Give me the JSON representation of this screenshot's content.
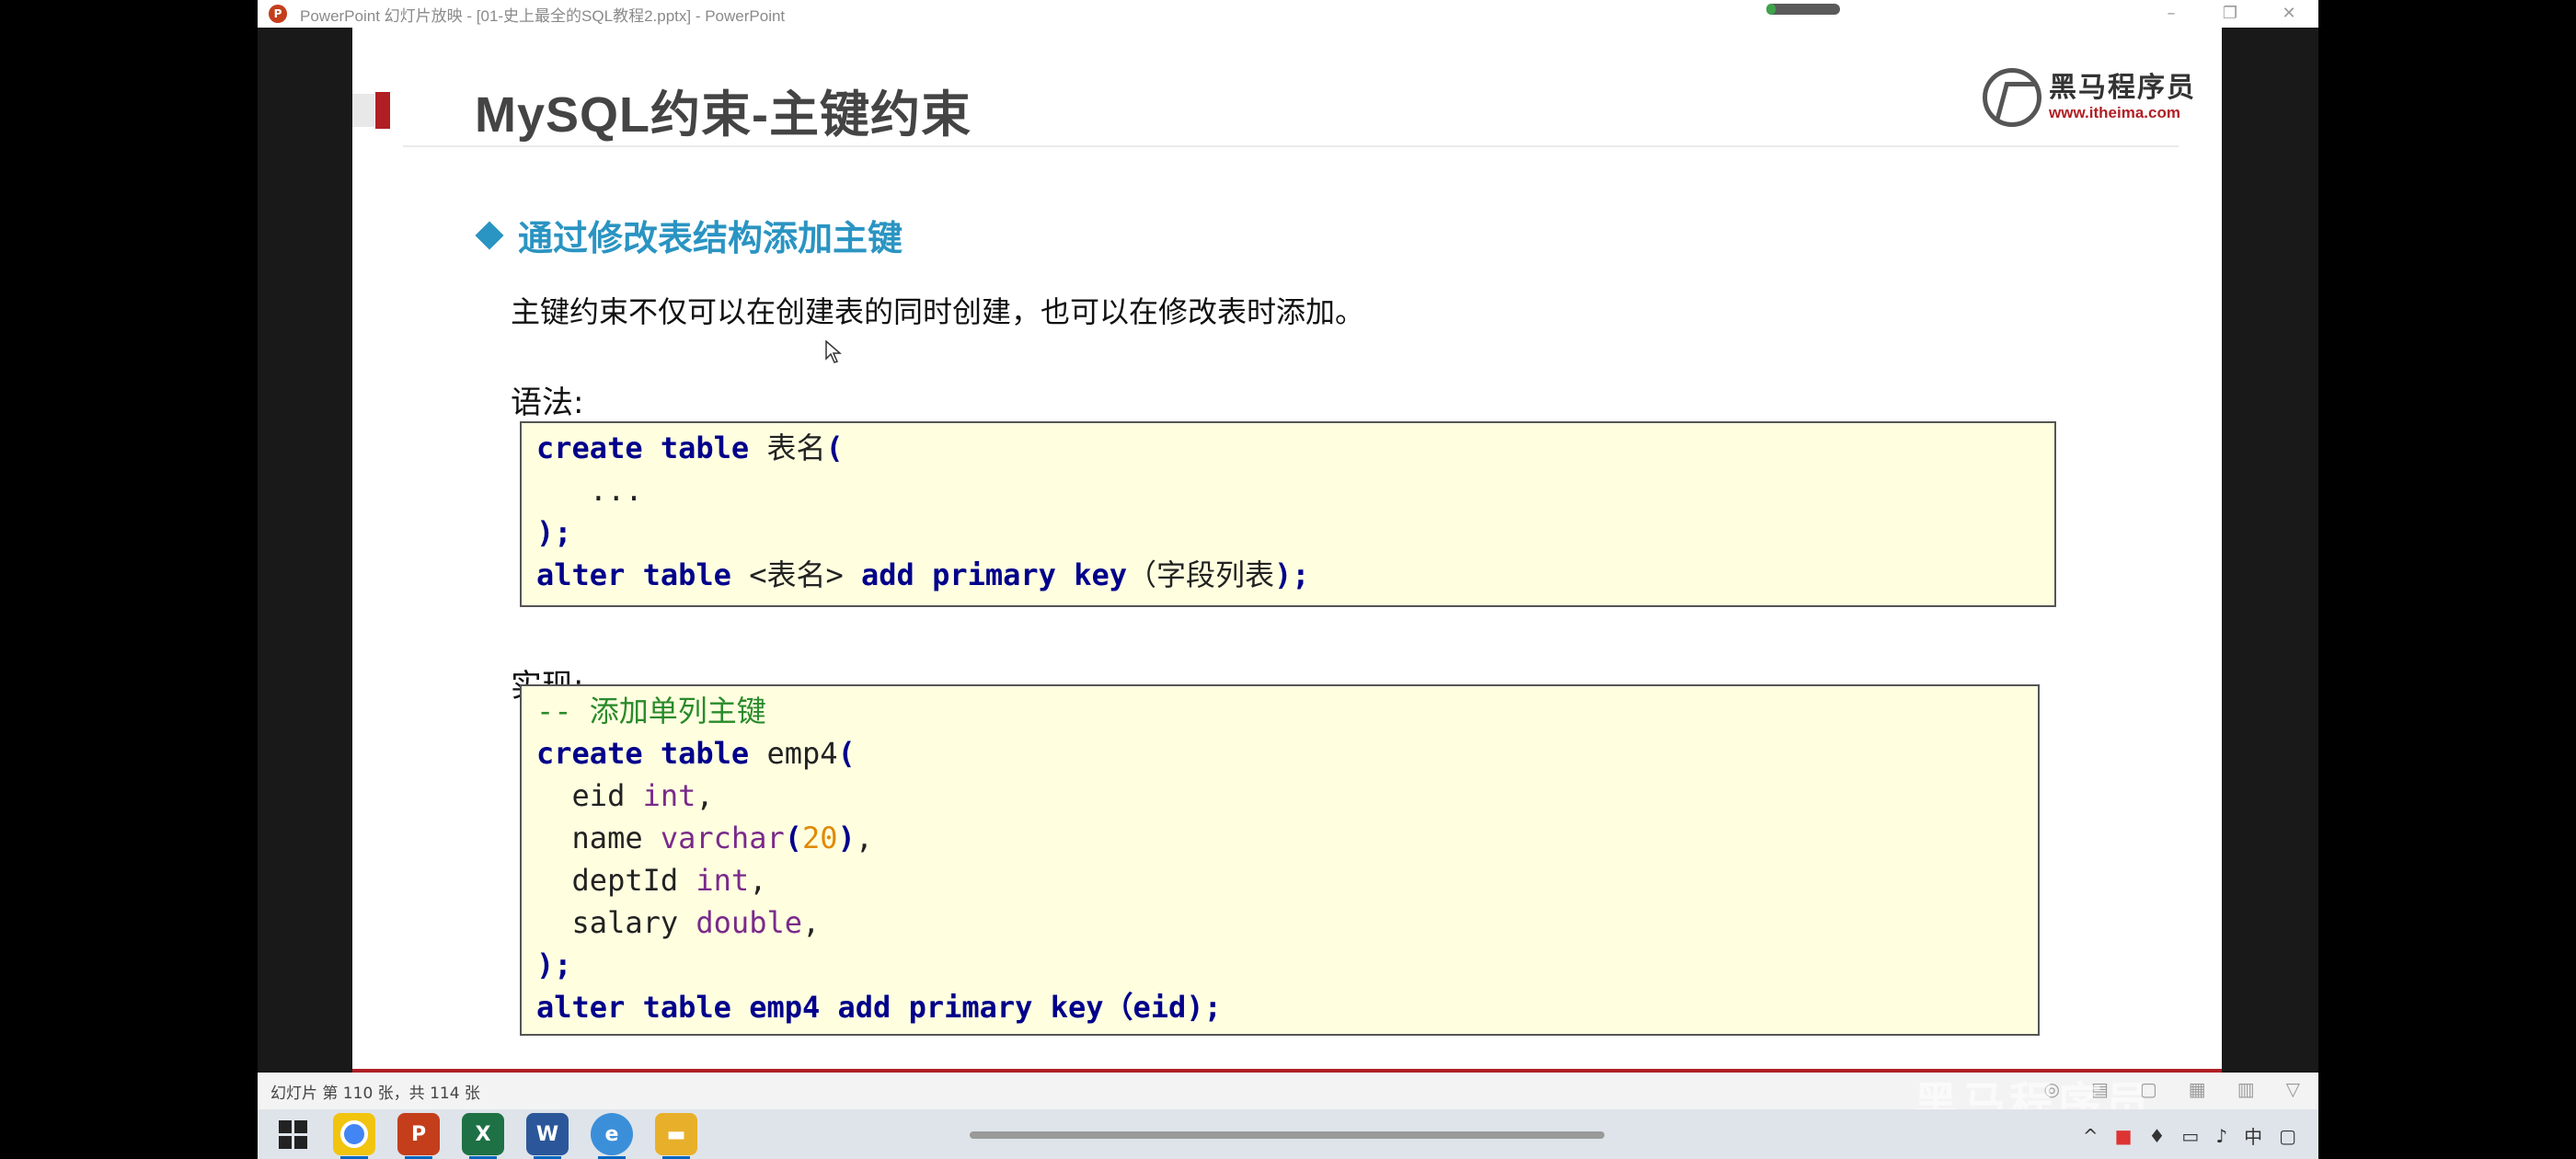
{
  "window": {
    "title": "PowerPoint 幻灯片放映 - [01-史上最全的SQL教程2.pptx] - PowerPoint",
    "app_icon": "powerpoint-icon",
    "controls": [
      "minimize-icon",
      "restore-icon",
      "close-icon"
    ]
  },
  "slide": {
    "heading": "MySQL约束-主键约束",
    "brand": {
      "name": "黑马程序员",
      "url": "www.itheima.com"
    },
    "subheading": "通过修改表结构添加主键",
    "description": "主键约束不仅可以在创建表的同时创建，也可以在修改表时添加。",
    "syntax_label": "语法:",
    "impl_label": "实现:",
    "syntax_code": [
      "create table 表名(",
      "   ...",
      ");",
      "alter table <表名> add primary key（字段列表);"
    ],
    "impl_code": [
      "-- 添加单列主键",
      "create table emp4(",
      "  eid int,",
      "  name varchar(20),",
      "  deptId int,",
      "  salary double,",
      ");",
      "alter table emp4 add primary key（eid);"
    ]
  },
  "status": {
    "slide_info": "幻灯片 第 110 张，共 114 张",
    "watermark": "黑马程序员"
  },
  "colors": {
    "accent_blue": "#2a94c2",
    "brand_red": "#b01f24",
    "keyword": "#00008b",
    "type": "#7a2a8a",
    "comment": "#2a8a2a",
    "code_bg": "#ffffe0"
  },
  "taskbar": {
    "apps": [
      "chrome-icon",
      "powerpoint-icon",
      "excel-icon",
      "word-icon",
      "browser-icon",
      "file-explorer-icon"
    ]
  }
}
